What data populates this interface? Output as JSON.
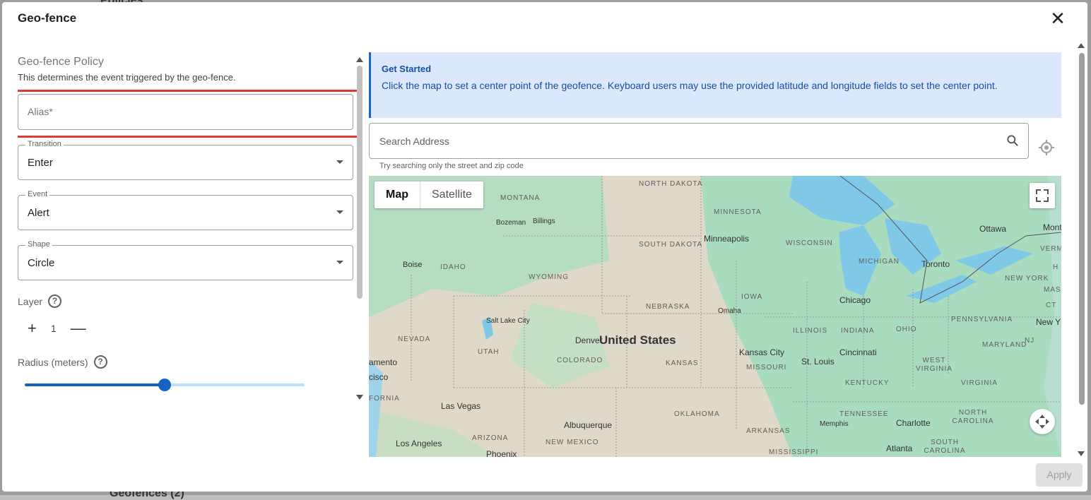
{
  "background": {
    "top_text": "Policies",
    "bottom_text": "Geofences (2)"
  },
  "dialog": {
    "title": "Geo-fence",
    "close_glyph": "✕"
  },
  "policy": {
    "section_title": "Geo-fence Policy",
    "section_desc": "This determines the event triggered by the geo-fence.",
    "alias_placeholder": "Alias*",
    "transition": {
      "label": "Transition",
      "value": "Enter"
    },
    "event": {
      "label": "Event",
      "value": "Alert"
    },
    "shape": {
      "label": "Shape",
      "value": "Circle"
    },
    "layer": {
      "label": "Layer",
      "value": "1",
      "plus": "+",
      "minus": "—"
    },
    "radius": {
      "label": "Radius (meters)",
      "slider_fraction": 0.5
    },
    "help_glyph": "?"
  },
  "info": {
    "heading": "Get Started",
    "body": "Click the map to set a center point of the geofence. Keyboard users may use the provided latitude and longitude fields to set the center point."
  },
  "search": {
    "placeholder": "Search Address",
    "hint": "Try searching only the street and zip code"
  },
  "map": {
    "tab_map": "Map",
    "tab_satellite": "Satellite",
    "country": "United States",
    "states": [
      "NORTH DAKOTA",
      "MONTANA",
      "MINNESOTA",
      "SOUTH DAKOTA",
      "WISCONSIN",
      "MICHIGAN",
      "IDAHO",
      "WYOMING",
      "IOWA",
      "NEBRASKA",
      "NEVADA",
      "UTAH",
      "COLORADO",
      "KANSAS",
      "MISSOURI",
      "ILLINOIS",
      "INDIANA",
      "OHIO",
      "PENNSYLVANIA",
      "KENTUCKY",
      "WEST VIRGINIA",
      "VIRGINIA",
      "MARYLAND",
      "OKLAHOMA",
      "ARKANSAS",
      "TENNESSEE",
      "NORTH CAROLINA",
      "SOUTH CAROLINA",
      "ARIZONA",
      "NEW MEXICO",
      "MISSISSIPPI",
      "NEW YORK",
      "VERMO",
      "MASSA",
      "CT",
      "H",
      "NJ",
      "FORNIA"
    ],
    "cities": [
      "Bozeman",
      "Billings",
      "Minneapolis",
      "Ottawa",
      "Mont",
      "Boise",
      "Toronto",
      "Chicago",
      "Omaha",
      "Salt Lake City",
      "Denver",
      "New Y",
      "Kansas City",
      "St. Louis",
      "Cincinnati",
      "amento",
      "cisco",
      "Las Vegas",
      "Albuquerque",
      "Memphis",
      "Charlotte",
      "Los Angeles",
      "Phoenix",
      "Atlanta"
    ]
  },
  "apply_label": "Apply",
  "colors": {
    "accent": "#1565c0",
    "highlight": "#e53935",
    "info_bg": "#dbe8fb",
    "water": "#7fc8e8",
    "land_green": "#a8dcc0"
  }
}
